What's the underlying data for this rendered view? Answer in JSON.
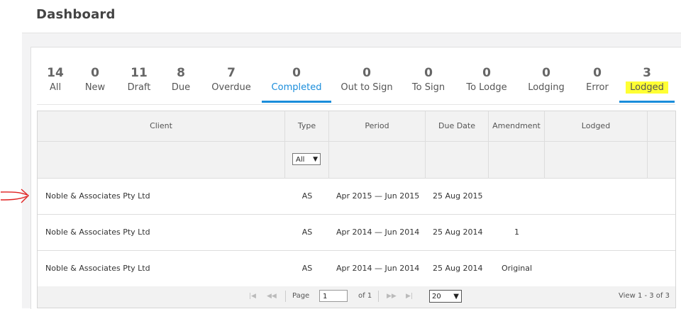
{
  "header": {
    "title": "Dashboard"
  },
  "tabs": [
    {
      "count": "14",
      "label": "All"
    },
    {
      "count": "0",
      "label": "New"
    },
    {
      "count": "11",
      "label": "Draft"
    },
    {
      "count": "8",
      "label": "Due"
    },
    {
      "count": "7",
      "label": "Overdue"
    },
    {
      "count": "0",
      "label": "Completed"
    },
    {
      "count": "0",
      "label": "Out to Sign"
    },
    {
      "count": "0",
      "label": "To Sign"
    },
    {
      "count": "0",
      "label": "To Lodge"
    },
    {
      "count": "0",
      "label": "Lodging"
    },
    {
      "count": "0",
      "label": "Error"
    },
    {
      "count": "3",
      "label": "Lodged"
    }
  ],
  "grid": {
    "columns": [
      "Client",
      "Type",
      "Period",
      "Due Date",
      "Amendment",
      "Lodged"
    ],
    "type_filter": "All",
    "rows": [
      {
        "client": "Noble & Associates Pty Ltd",
        "type": "AS",
        "period": "Apr 2015 — Jun 2015",
        "due": "25 Aug 2015",
        "amendment": "",
        "lodged": ""
      },
      {
        "client": "Noble & Associates Pty Ltd",
        "type": "AS",
        "period": "Apr 2014 — Jun 2014",
        "due": "25 Aug 2014",
        "amendment": "1",
        "lodged": ""
      },
      {
        "client": "Noble & Associates Pty Ltd",
        "type": "AS",
        "period": "Apr 2014 — Jun 2014",
        "due": "25 Aug 2014",
        "amendment": "Original",
        "lodged": ""
      }
    ]
  },
  "pager": {
    "page_label": "Page",
    "page_value": "1",
    "of_label": "of 1",
    "page_size": "20",
    "view_text": "View 1 - 3 of 3"
  },
  "colors": {
    "accent": "#1a8ddb",
    "highlight": "#ffff33",
    "annotation": "#e02020"
  }
}
